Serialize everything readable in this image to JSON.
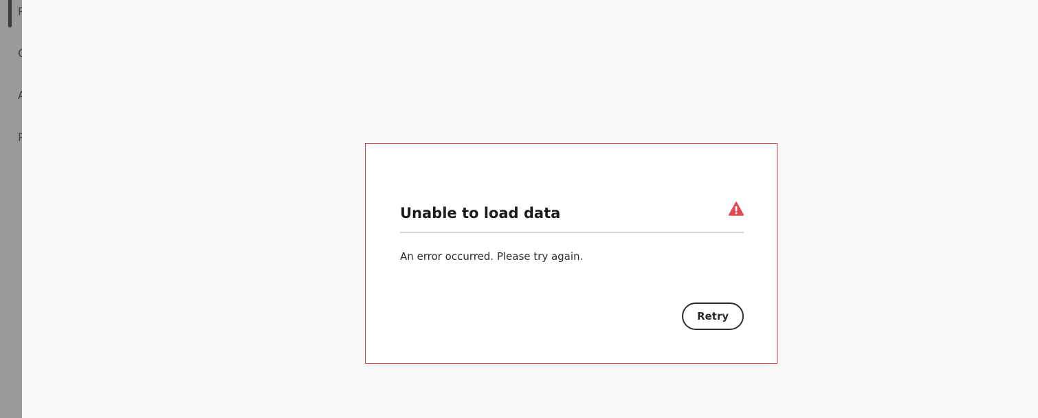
{
  "side_rail": {
    "items": [
      {
        "label": "P"
      },
      {
        "label": "C"
      },
      {
        "label": "A"
      },
      {
        "label": "P"
      }
    ]
  },
  "dialog": {
    "title": "Unable to load data",
    "icon": "alert-icon",
    "message": "An error occurred. Please try again.",
    "retry_label": "Retry",
    "border_color": "#d7373f",
    "icon_color": "#e34850"
  }
}
